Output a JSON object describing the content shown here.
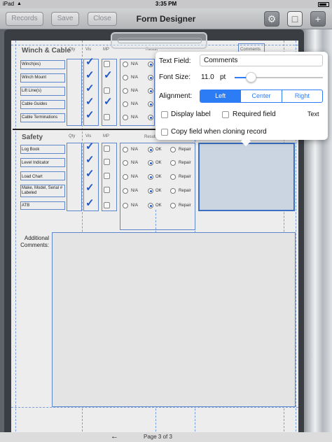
{
  "status": {
    "carrier": "iPad",
    "time": "3:35 PM"
  },
  "navbar": {
    "records_label": "Records",
    "save_label": "Save",
    "close_label": "Close",
    "title": "Form Designer",
    "settings_icon": "gear-icon",
    "document_icon": "document-icon",
    "add_icon": "plus-icon"
  },
  "form": {
    "col_qty": "Qty",
    "col_vis": "Vis",
    "col_mp": "MP",
    "col_result": "Result",
    "col_comments": "Comments",
    "section1_title": "Winch & Cable",
    "section1_rows": [
      "Winch(es)",
      "Winch Mount",
      "Lift Line(s)",
      "Cable Guides",
      "Cable Terminations"
    ],
    "section2_title": "Safety",
    "section2_rows": [
      "Log Book",
      "Level Indicator",
      "Load Chart",
      "Make, Model, Serial # Labeled",
      "ATB"
    ],
    "opt_na": "N/A",
    "opt_ok": "OK",
    "opt_repair": "Repair",
    "additional_comments": "Additional Comments:"
  },
  "popover": {
    "text_field_label": "Text Field:",
    "text_field_value": "Comments",
    "font_size_label": "Font Size:",
    "font_size_value": "11.0",
    "font_size_unit": "pt",
    "font_size_slider_fraction": 0.18,
    "alignment_label": "Alignment:",
    "alignment_options": [
      "Left",
      "Center",
      "Right"
    ],
    "alignment_selected": "Left",
    "display_label": "Display label",
    "required_field": "Required field",
    "type_text": "Text",
    "copy_field": "Copy field when cloning record"
  },
  "footer": {
    "page_label": "Page 3 of 3"
  },
  "colors": {
    "accent": "#2c7cf6",
    "check": "#1f57c8",
    "selection": "#3b6fc6"
  }
}
